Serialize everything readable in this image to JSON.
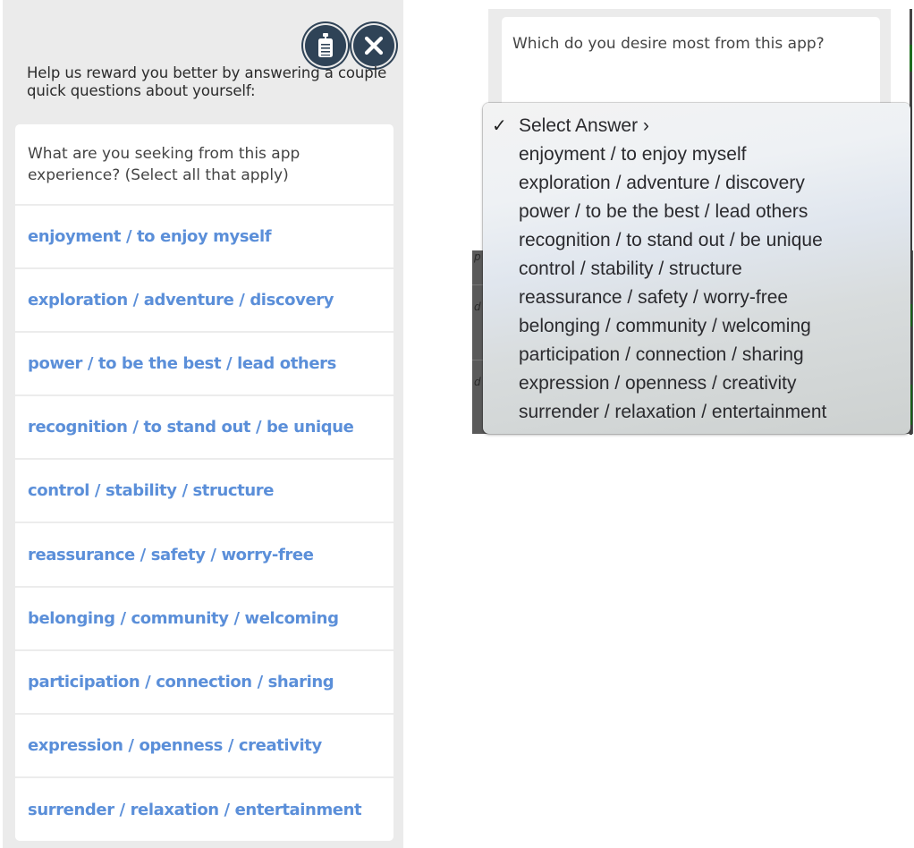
{
  "left_panel": {
    "header_icons": [
      {
        "name": "survey-clipboard-icon"
      },
      {
        "name": "close-icon"
      }
    ],
    "intro_text": "Help us reward you better by answering a couple quick questions about yourself:",
    "question": "What are you seeking from this app experience? (Select all that apply)",
    "options": [
      "enjoyment / to enjoy myself",
      "exploration / adventure / discovery",
      "power / to be the best / lead others",
      "recognition / to stand out / be unique",
      "control / stability / structure",
      "reassurance / safety / worry-free",
      "belonging / community / welcoming",
      "participation / connection / sharing",
      "expression / openness / creativity",
      "surrender / relaxation / entertainment"
    ],
    "option_color": "#5b8fd9"
  },
  "right_panel": {
    "question": "Which do you desire most from this app?",
    "dropdown": {
      "selected": "Select Answer ›",
      "check_glyph": "✓",
      "options": [
        "enjoyment / to enjoy myself",
        "exploration / adventure / discovery",
        "power / to be the best / lead others",
        "recognition / to stand out / be unique",
        "control / stability / structure",
        "reassurance / safety / worry-free",
        "belonging / community / welcoming",
        "participation / connection / sharing",
        "expression / openness / creativity",
        "surrender / relaxation / entertainment"
      ]
    }
  }
}
